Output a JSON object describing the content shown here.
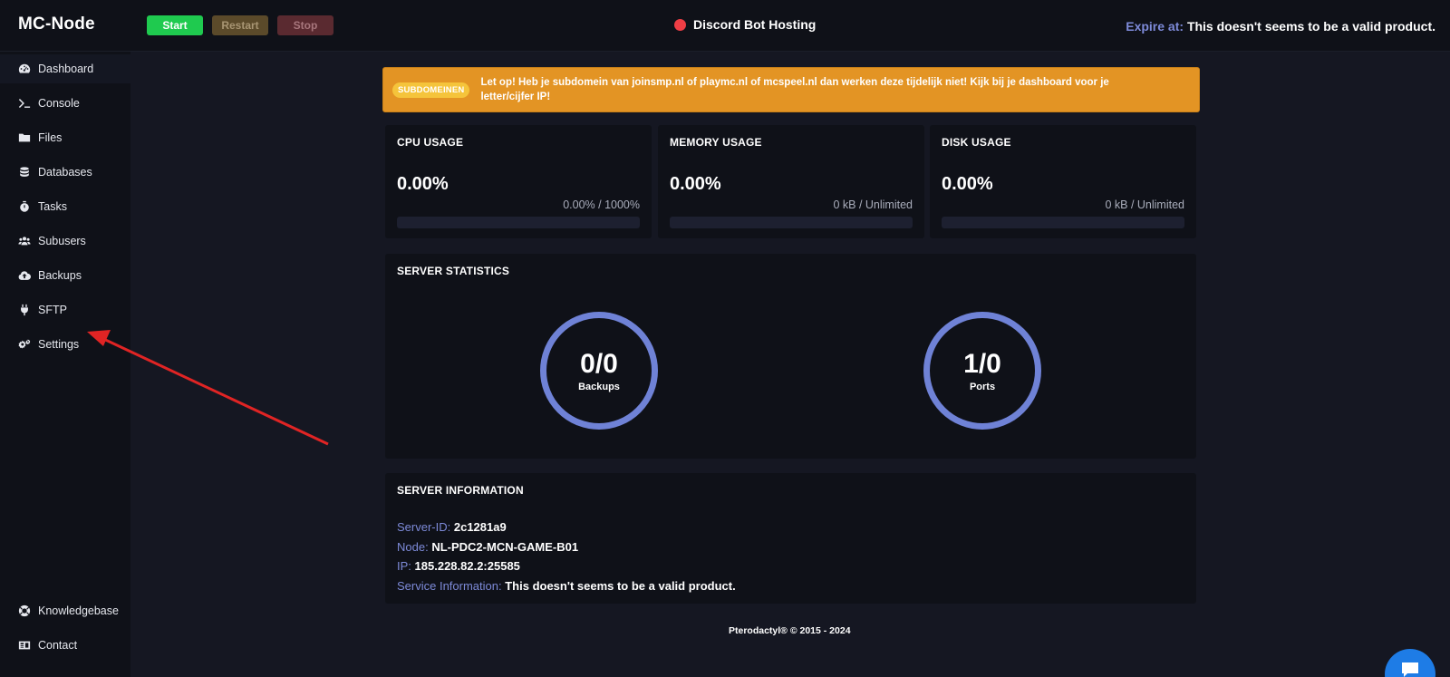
{
  "header": {
    "brand": "MC-Node",
    "buttons": {
      "start": "Start",
      "restart": "Restart",
      "stop": "Stop"
    },
    "server_name": "Discord Bot Hosting",
    "expire_label": "Expire at:",
    "expire_value": "This doesn't seems to be a valid product."
  },
  "sidebar": {
    "items": [
      {
        "label": "Dashboard",
        "icon": "dashboard-icon"
      },
      {
        "label": "Console",
        "icon": "terminal-icon"
      },
      {
        "label": "Files",
        "icon": "folder-icon"
      },
      {
        "label": "Databases",
        "icon": "database-icon"
      },
      {
        "label": "Tasks",
        "icon": "stopwatch-icon"
      },
      {
        "label": "Subusers",
        "icon": "users-icon"
      },
      {
        "label": "Backups",
        "icon": "cloud-upload-icon"
      },
      {
        "label": "SFTP",
        "icon": "plug-icon"
      },
      {
        "label": "Settings",
        "icon": "cogs-icon"
      }
    ],
    "bottom_items": [
      {
        "label": "Knowledgebase",
        "icon": "life-ring-icon"
      },
      {
        "label": "Contact",
        "icon": "id-card-icon"
      }
    ]
  },
  "banner": {
    "badge": "SUBDOMEINEN",
    "text": "Let op! Heb je subdomein van joinsmp.nl of playmc.nl of mcspeel.nl dan werken deze tijdelijk niet! Kijk bij je dashboard voor je letter/cijfer IP!"
  },
  "usage": {
    "cpu": {
      "title": "CPU USAGE",
      "value": "0.00%",
      "detail": "0.00% / 1000%",
      "fill": 0
    },
    "memory": {
      "title": "MEMORY USAGE",
      "value": "0.00%",
      "detail": "0 kB / Unlimited",
      "fill": 0
    },
    "disk": {
      "title": "DISK USAGE",
      "value": "0.00%",
      "detail": "0 kB / Unlimited",
      "fill": 0
    }
  },
  "statistics": {
    "title": "SERVER STATISTICS",
    "backups": {
      "value": "0/0",
      "label": "Backups"
    },
    "ports": {
      "value": "1/0",
      "label": "Ports"
    }
  },
  "information": {
    "title": "SERVER INFORMATION",
    "server_id_label": "Server-ID:",
    "server_id": "2c1281a9",
    "node_label": "Node:",
    "node": "NL-PDC2-MCN-GAME-B01",
    "ip_label": "IP:",
    "ip": "185.228.82.2:25585",
    "service_label": "Service Information:",
    "service": "This doesn't seems to be a valid product."
  },
  "footer": {
    "text": "Pterodactyl® © 2015 - 2024"
  },
  "colors": {
    "accent": "#6f82d6",
    "start": "#1fca4f",
    "status_offline": "#ef3e45",
    "banner": "#e39424",
    "annotation_arrow": "#e02424"
  }
}
